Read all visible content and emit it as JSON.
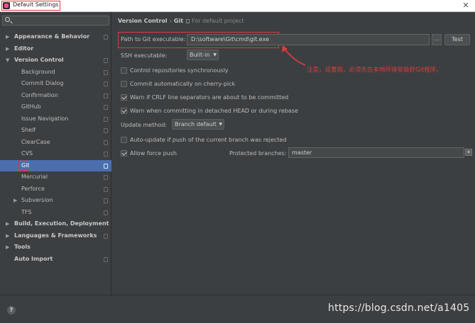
{
  "window": {
    "title": "Default Settings"
  },
  "search": {
    "placeholder": ""
  },
  "sidebar": {
    "items": [
      {
        "label": "Appearance & Behavior",
        "expanded": false,
        "level": 0
      },
      {
        "label": "Editor",
        "expanded": false,
        "level": 0
      },
      {
        "label": "Version Control",
        "expanded": true,
        "level": 0
      },
      {
        "label": "Background",
        "level": 1
      },
      {
        "label": "Commit Dialog",
        "level": 1
      },
      {
        "label": "Confirmation",
        "level": 1
      },
      {
        "label": "GitHub",
        "level": 1
      },
      {
        "label": "Issue Navigation",
        "level": 1
      },
      {
        "label": "Shelf",
        "level": 1
      },
      {
        "label": "ClearCase",
        "level": 1
      },
      {
        "label": "CVS",
        "level": 1
      },
      {
        "label": "Git",
        "level": 1,
        "selected": true
      },
      {
        "label": "Mercurial",
        "level": 1
      },
      {
        "label": "Perforce",
        "level": 1
      },
      {
        "label": "Subversion",
        "level": 1,
        "expanded": false
      },
      {
        "label": "TFS",
        "level": 1
      },
      {
        "label": "Build, Execution, Deployment",
        "expanded": false,
        "level": 0
      },
      {
        "label": "Languages & Frameworks",
        "expanded": false,
        "level": 0
      },
      {
        "label": "Tools",
        "expanded": false,
        "level": 0
      },
      {
        "label": "Auto Import",
        "level": 0
      }
    ]
  },
  "breadcrumb": {
    "part1": "Version Control",
    "separator": "›",
    "part2": "Git",
    "note": "For default project"
  },
  "git": {
    "path_label": "Path to Git executable:",
    "path_value": "D:\\software\\Git\\cmd\\git.exe",
    "browse_label": "...",
    "test_label": "Test",
    "ssh_label": "SSH executable:",
    "ssh_value": "Built-in",
    "cb_sync_label": "Control repositories synchronously",
    "cb_cherry_label": "Commit automatically on cherry-pick",
    "cb_crlf_label": "Warn if CRLF line separators are about to be committed",
    "cb_detached_label": "Warn when committing in detached HEAD or during rebase",
    "update_label": "Update method:",
    "update_value": "Branch default",
    "cb_autoupdate_label": "Auto-update if push of the current branch was rejected",
    "cb_force_label": "Allow force push",
    "protected_label": "Protected branches:",
    "protected_value": "master",
    "add_label": "+"
  },
  "checkbox_states": {
    "sync": false,
    "cherry": false,
    "crlf": true,
    "detached": true,
    "autoupdate": false,
    "force": true
  },
  "annotation": {
    "text": "注意，设置前，必须先在本地环境安装好Git程序。"
  },
  "footer": {
    "help_label": "?",
    "watermark": "https://blog.csdn.net/a1405"
  },
  "colors": {
    "background": "#3c3f41",
    "selection": "#4b6eaf",
    "highlight": "#e03a3a"
  }
}
